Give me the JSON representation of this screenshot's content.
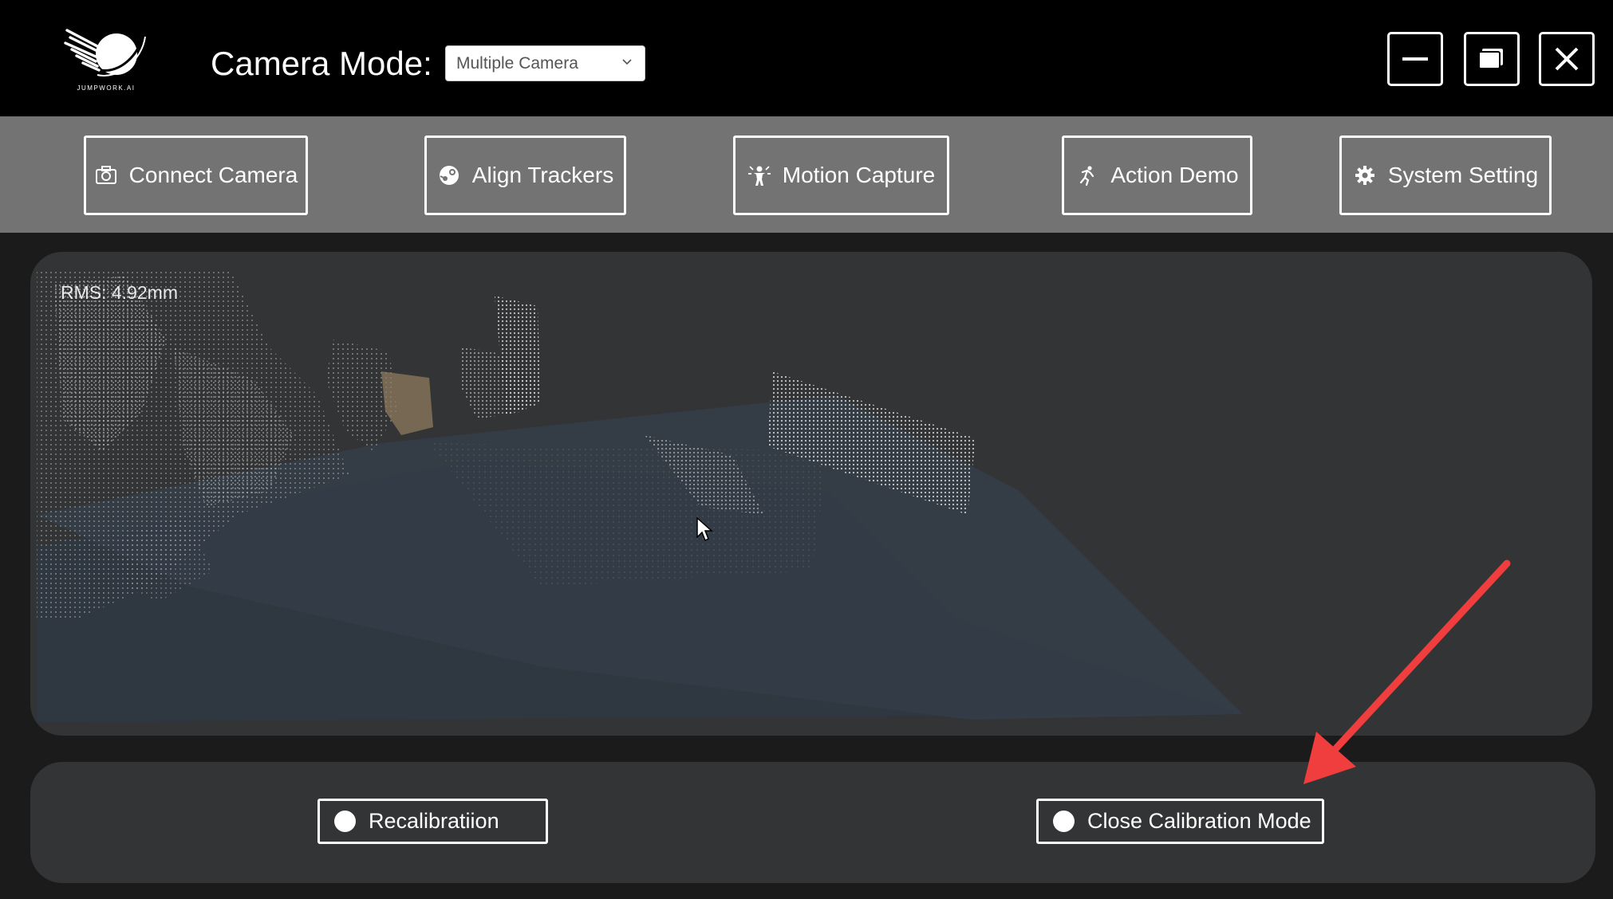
{
  "titlebar": {
    "logo_text": "JUMPWORK.AI",
    "camera_mode_label": "Camera Mode:",
    "camera_mode_selected": "Multiple Camera",
    "window_controls": [
      "minimize-icon",
      "maximize-icon",
      "close-icon"
    ]
  },
  "toolbar": {
    "items": [
      {
        "label": "Connect Camera",
        "icon": "camera-icon"
      },
      {
        "label": "Align Trackers",
        "icon": "steam-icon"
      },
      {
        "label": "Motion Capture",
        "icon": "person-motion-icon"
      },
      {
        "label": "Action Demo",
        "icon": "running-icon"
      },
      {
        "label": "System Setting",
        "icon": "gear-icon"
      }
    ]
  },
  "viewport": {
    "rms_text": "RMS: 4.92mm"
  },
  "bottom": {
    "recalibration_label": "Recalibratiion",
    "close_calibration_label": "Close Calibration Mode"
  },
  "colors": {
    "titlebar_bg": "#000000",
    "toolbar_bg": "#737373",
    "panel_bg": "#333435",
    "annotation_arrow": "#f03e3e"
  }
}
